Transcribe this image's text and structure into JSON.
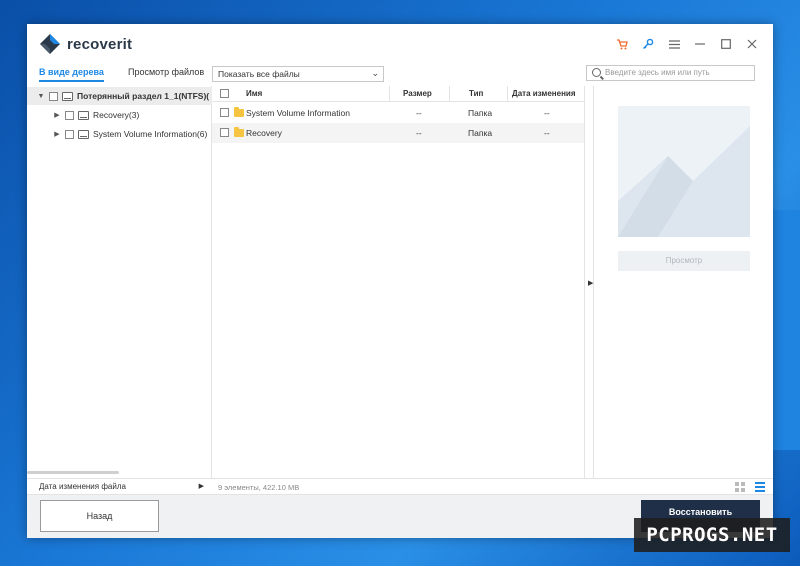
{
  "app": {
    "logo_text": "recoverit"
  },
  "titlebar": {
    "icons": [
      "cart-icon",
      "key-icon",
      "menu-icon",
      "minimize-icon",
      "maximize-icon",
      "close-icon"
    ]
  },
  "toolbar": {
    "tab_tree": "В виде дерева",
    "tab_files": "Просмотр файлов",
    "filter_value": "Показать все файлы",
    "search_placeholder": "Введите здесь имя или путь"
  },
  "tree": {
    "root_label": "Потерянный раздел 1_1(NTFS)(",
    "items": [
      {
        "label": "Recovery(3)"
      },
      {
        "label": "System Volume Information(6)"
      }
    ],
    "footer_label": "Дата изменения файла"
  },
  "files": {
    "columns": {
      "name": "Имя",
      "size": "Размер",
      "type": "Тип",
      "date": "Дата изменения"
    },
    "rows": [
      {
        "name": "System Volume Information",
        "size": "--",
        "type": "Папка",
        "date": "--"
      },
      {
        "name": "Recovery",
        "size": "--",
        "type": "Папка",
        "date": "--"
      }
    ],
    "status": "9 элементы, 422.10  MB"
  },
  "preview": {
    "button_label": "Просмотр"
  },
  "bottom": {
    "back_label": "Назад",
    "recover_label": "Восстановить"
  },
  "watermark": "PCPROGS.NET",
  "colors": {
    "accent": "#1e88e5",
    "recover_button": "#1f2f47",
    "folder": "#f5c542"
  }
}
